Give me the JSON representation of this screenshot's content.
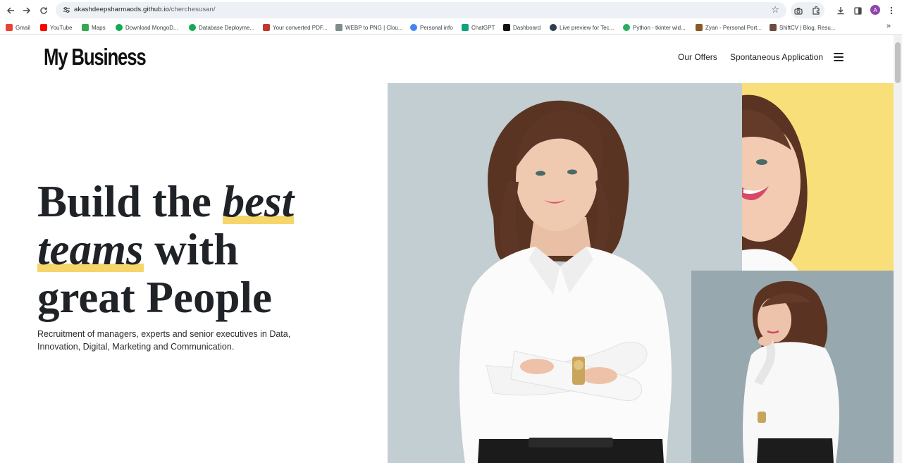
{
  "browser": {
    "url_host": "akashdeepsharmaods.github.io",
    "url_path": "/cherchesusan/",
    "profile_initial": "A",
    "icons": [
      "back-icon",
      "forward-icon",
      "reload-icon",
      "site-info-icon",
      "star-icon",
      "camera-icon",
      "extensions-icon",
      "download-icon",
      "side-panel-icon",
      "menu-icon"
    ]
  },
  "bookmarks": [
    {
      "label": "Gmail",
      "color": "#ea4335"
    },
    {
      "label": "YouTube",
      "color": "#ff0000"
    },
    {
      "label": "Maps",
      "color": "#34a853"
    },
    {
      "label": "Download MongoD...",
      "color": "#13aa52"
    },
    {
      "label": "Database Deployme...",
      "color": "#13aa52"
    },
    {
      "label": "Your converted PDF...",
      "color": "#c0392b"
    },
    {
      "label": "WEBP to PNG | Clou...",
      "color": "#7f8c8d"
    },
    {
      "label": "Personal info",
      "color": "#4285f4"
    },
    {
      "label": "ChatGPT",
      "color": "#10a37f"
    },
    {
      "label": "Dashboard",
      "color": "#111111"
    },
    {
      "label": "Live preview for Tec...",
      "color": "#2c3e50"
    },
    {
      "label": "Python - tkinter wid...",
      "color": "#27ae60"
    },
    {
      "label": "Zyan - Personal Port...",
      "color": "#8b5a2b"
    },
    {
      "label": "ShiftCV | Blog, Resu...",
      "color": "#6d4c41"
    }
  ],
  "header": {
    "logo": "My Business",
    "nav": [
      "Our Offers",
      "Spontaneous Application"
    ]
  },
  "hero": {
    "line1_plain": "Build the ",
    "line1_em": "best",
    "line2_em": "teams",
    "line2_plain": " with",
    "line3": "great People",
    "subtext": "Recruitment of managers, experts and senior executives in Data, Innovation, Digital, Marketing and Communication.",
    "highlight_color": "#f6d66a",
    "panel_colors": {
      "main": "#c2ced1",
      "accent": "#f9df7a",
      "secondary": "#97a8ae"
    }
  }
}
